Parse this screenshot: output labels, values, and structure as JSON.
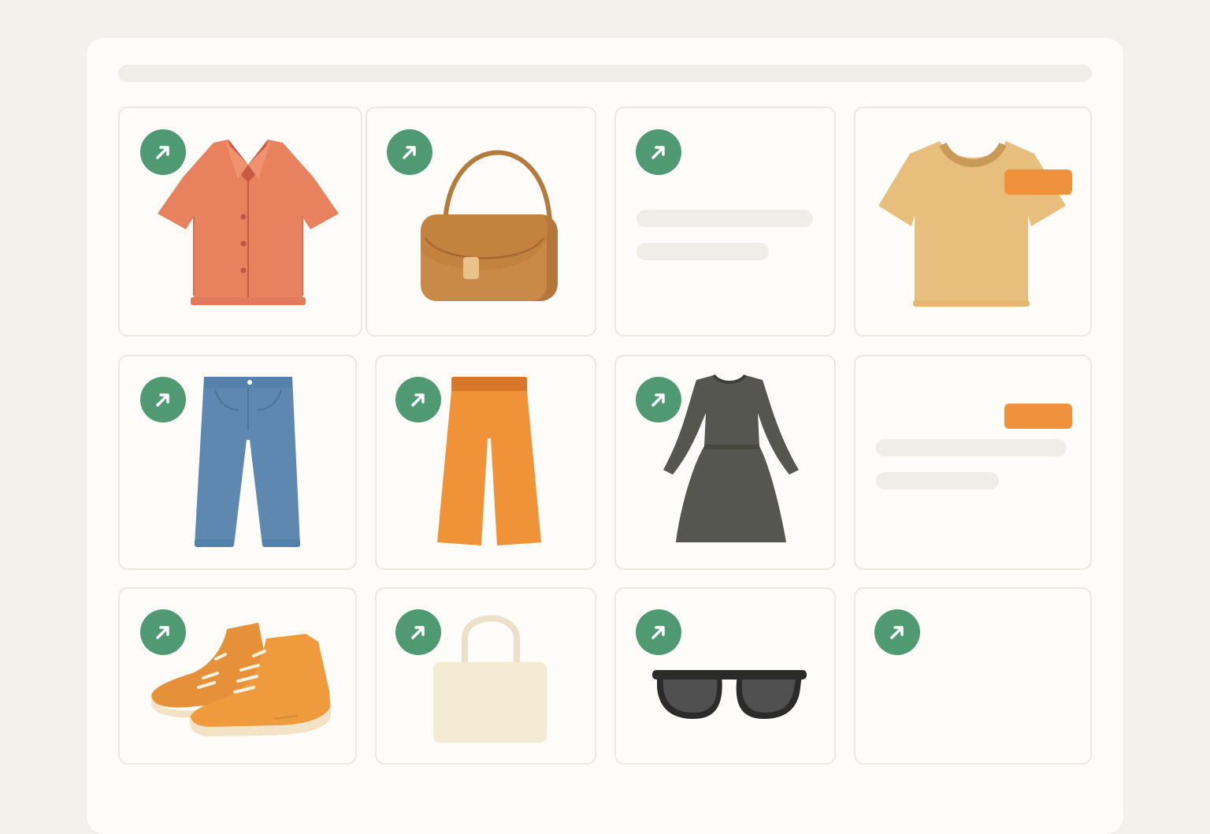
{
  "colors": {
    "background": "#f3f1ec",
    "panel": "#fdfcf8",
    "trend_badge": "#4f9a72",
    "highlight_tag": "#f0923c",
    "skeleton": "#efede8"
  },
  "header": {
    "loading_bar": "skeleton"
  },
  "grid": {
    "items": [
      {
        "item": "shirt",
        "icon": "trending-up-icon",
        "trending": true
      },
      {
        "item": "handbag",
        "icon": "trending-up-icon",
        "trending": true
      },
      {
        "item": "placeholder",
        "icon": "trending-up-icon",
        "trending": true
      },
      {
        "item": "t-shirt",
        "highlight_tag": true
      },
      {
        "item": "jeans",
        "icon": "trending-up-icon",
        "trending": true
      },
      {
        "item": "pants",
        "icon": "trending-up-icon",
        "trending": true
      },
      {
        "item": "dress",
        "icon": "trending-up-icon",
        "trending": true
      },
      {
        "item": "placeholder",
        "highlight_tag": true
      },
      {
        "item": "sneakers",
        "icon": "trending-up-icon",
        "trending": true
      },
      {
        "item": "tote-bag",
        "icon": "trending-up-icon",
        "trending": true
      },
      {
        "item": "sunglasses",
        "icon": "trending-up-icon",
        "trending": true
      },
      {
        "item": "placeholder",
        "icon": "trending-up-icon",
        "trending": true
      }
    ]
  }
}
